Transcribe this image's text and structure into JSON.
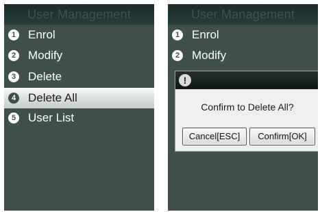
{
  "left_screen": {
    "title": "User Management",
    "menu": [
      {
        "number": "1",
        "label": "Enrol"
      },
      {
        "number": "2",
        "label": "Modify"
      },
      {
        "number": "3",
        "label": "Delete"
      },
      {
        "number": "4",
        "label": "Delete All",
        "selected": true
      },
      {
        "number": "5",
        "label": "User List"
      }
    ]
  },
  "right_screen": {
    "title": "User Management",
    "menu": [
      {
        "number": "1",
        "label": "Enrol"
      },
      {
        "number": "2",
        "label": "Modify"
      }
    ],
    "dialog": {
      "icon": "exclamation-icon",
      "message": "Confirm to Delete All?",
      "cancel_label": "Cancel[ESC]",
      "confirm_label": "Confirm[OK]"
    }
  },
  "colors": {
    "screen_background": "#3f4f4a",
    "title_bar": "#203533",
    "selected_item": "#d7dbdb",
    "dialog_background": "#efefef"
  }
}
